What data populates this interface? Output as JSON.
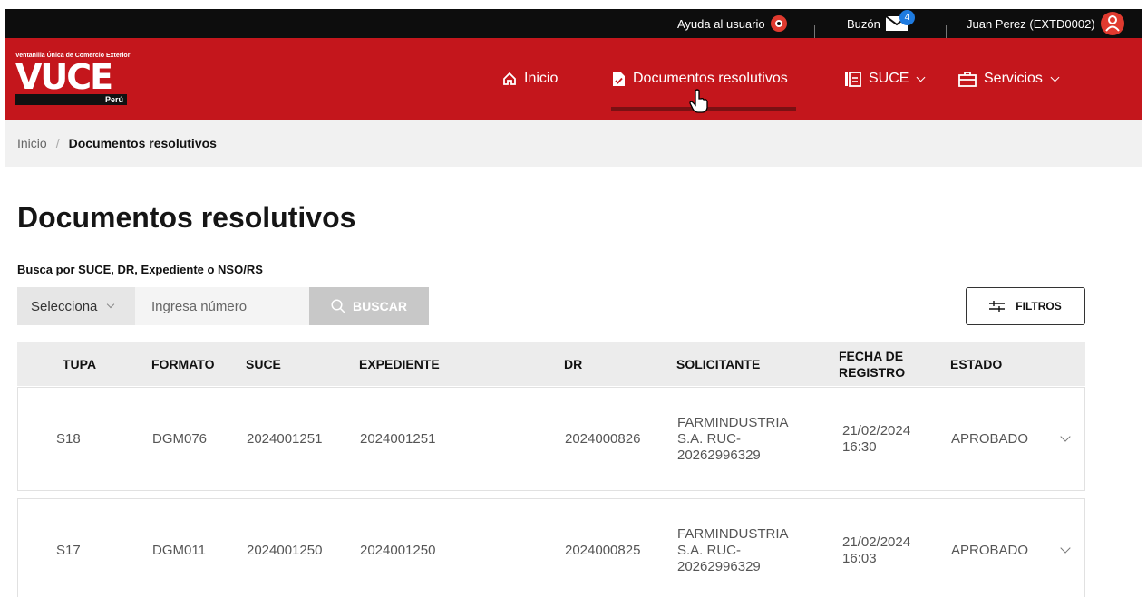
{
  "topbar": {
    "help_label": "Ayuda al usuario",
    "mail_label": "Buzón",
    "mail_count": "4",
    "user_label": "Juan Perez (EXTD0002)"
  },
  "logo": {
    "tagline": "Ventanilla Única de Comercio Exterior",
    "brand": "VUCE",
    "country": "Perú"
  },
  "nav": {
    "inicio": "Inicio",
    "documentos": "Documentos resolutivos",
    "suce": "SUCE",
    "servicios": "Servicios"
  },
  "breadcrumb": {
    "home": "Inicio",
    "separator": "/",
    "current": "Documentos resolutivos"
  },
  "page": {
    "title": "Documentos resolutivos",
    "search_label": "Busca por SUCE, DR, Expediente o NSO/RS"
  },
  "search": {
    "select_value": "Selecciona",
    "placeholder": "Ingresa número",
    "button_label": "BUSCAR",
    "filters_label": "FILTROS"
  },
  "table": {
    "headers": {
      "tupa": "TUPA",
      "formato": "FORMATO",
      "suce": "SUCE",
      "expediente": "EXPEDIENTE",
      "dr": "DR",
      "solicitante": "SOLICITANTE",
      "fecha": "FECHA DE REGISTRO",
      "estado": "ESTADO"
    },
    "rows": [
      {
        "tupa": "S18",
        "formato": "DGM076",
        "suce": "2024001251",
        "expediente": "2024001251",
        "dr": "2024000826",
        "solicitante": "FARMINDUSTRIA S.A. RUC-20262996329",
        "fecha": "21/02/2024 16:30",
        "estado": "APROBADO"
      },
      {
        "tupa": "S17",
        "formato": "DGM011",
        "suce": "2024001250",
        "expediente": "2024001250",
        "dr": "2024000825",
        "solicitante": "FARMINDUSTRIA S.A. RUC-20262996329",
        "fecha": "21/02/2024 16:03",
        "estado": "APROBADO"
      }
    ]
  }
}
